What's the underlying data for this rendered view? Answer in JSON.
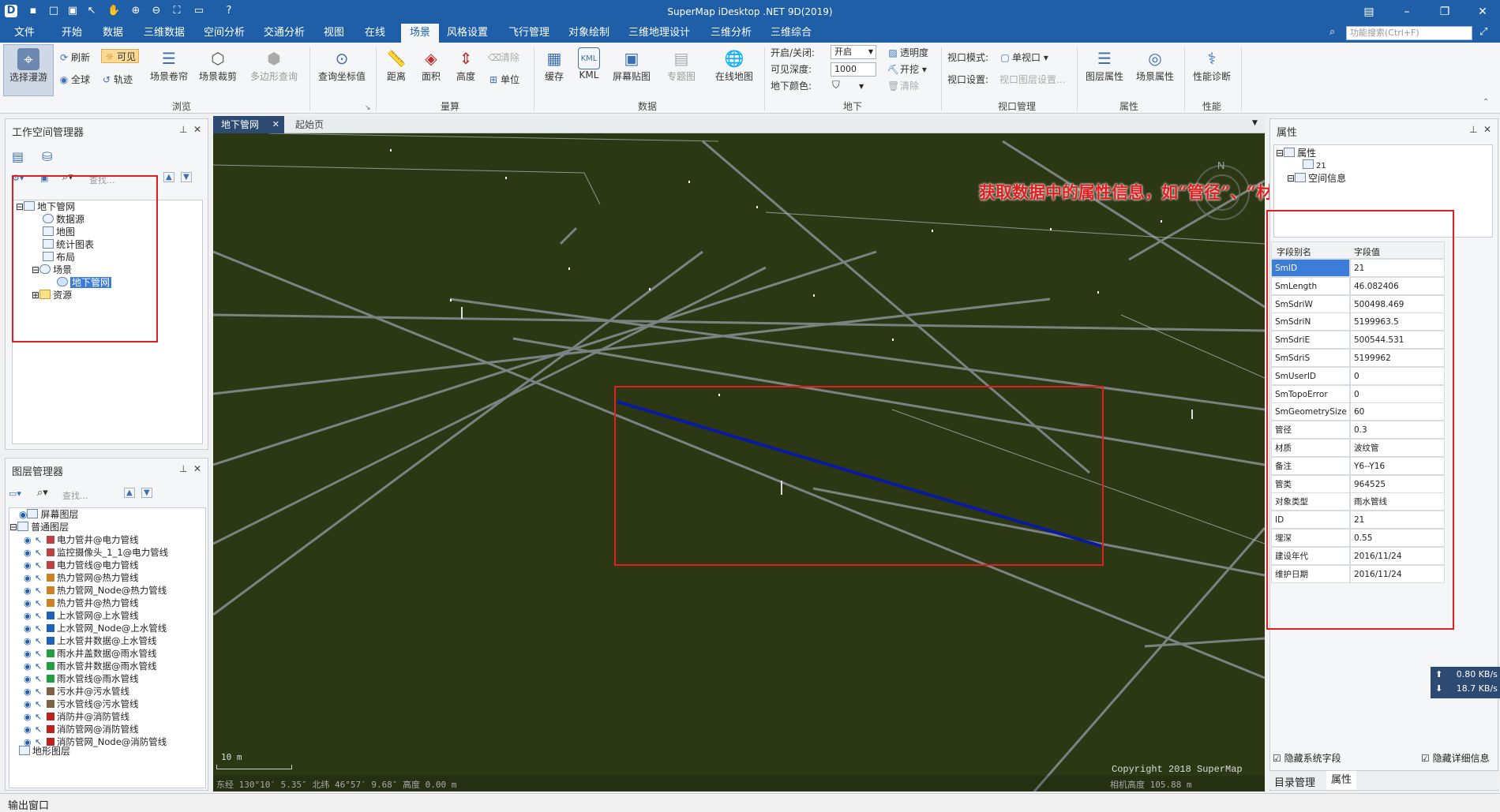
{
  "title_bar": {
    "title": "SuperMap iDesktop .NET 9D(2019)"
  },
  "menu": {
    "items": [
      "文件",
      "开始",
      "数据",
      "三维数据",
      "空间分析",
      "交通分析",
      "视图",
      "在线",
      "场景",
      "风格设置",
      "飞行管理",
      "对象绘制",
      "三维地理设计",
      "三维分析",
      "三维综合"
    ],
    "active": "场景",
    "search_placeholder": "功能搜索(Ctrl+F)"
  },
  "ribbon": {
    "browse": {
      "roam": "选择漫游",
      "refresh": "刷新",
      "visible": "可见",
      "full": "全球",
      "track": "轨迹",
      "scene_roll": "场景卷帘",
      "scene_clip": "场景裁剪",
      "polygon_query": "多边形查询",
      "group": "浏览"
    },
    "query_coord": "查询坐标值",
    "measure": {
      "distance": "距离",
      "area": "面积",
      "height": "高度",
      "clear": "清除",
      "unit": "单位",
      "group": "量算"
    },
    "data": {
      "cache": "缓存",
      "kml": "KML",
      "screen_map": "屏幕贴图",
      "thematic": "专题图",
      "online_map": "在线地图",
      "group": "数据"
    },
    "underground": {
      "toggle_label": "开启/关闭:",
      "toggle_value": "开启",
      "depth_label": "可见深度:",
      "depth_value": "1000",
      "color_label": "地下颜色:",
      "transparency": "透明度",
      "excavate": "开挖",
      "clear": "清除",
      "group": "地下"
    },
    "viewport": {
      "mode_label": "视口模式:",
      "mode_value": "单视口",
      "setting_label": "视口设置:",
      "setting_value": "视口图层设置...",
      "group": "视口管理"
    },
    "props": {
      "layer_prop": "图层属性",
      "scene_prop": "场景属性",
      "group": "属性"
    },
    "perf": {
      "diagnose": "性能诊断",
      "group": "性能"
    }
  },
  "workspace_panel": {
    "title": "工作空间管理器",
    "search_placeholder": "查找...",
    "tree": [
      "地下管网",
      "数据源",
      "地图",
      "统计图表",
      "布局",
      "场景",
      "地下管网",
      "资源"
    ]
  },
  "layer_panel": {
    "title": "图层管理器",
    "search_placeholder": "查找...",
    "groups": [
      "屏幕图层",
      "普通图层",
      "地形图层"
    ],
    "layers": [
      "电力管井@电力管线",
      "监控摄像头_1_1@电力管线",
      "电力管线@电力管线",
      "热力管网@热力管线",
      "热力管网_Node@热力管线",
      "热力管井@热力管线",
      "上水管网@上水管线",
      "上水管网_Node@上水管线",
      "上水管井数据@上水管线",
      "雨水井盖数据@雨水管线",
      "雨水管井数据@雨水管线",
      "雨水管线@雨水管线",
      "污水井@污水管线",
      "污水管线@污水管线",
      "消防井@消防管线",
      "消防管网@消防管线",
      "消防管网_Node@消防管线"
    ]
  },
  "doc_tabs": [
    "地下管网",
    "起始页"
  ],
  "scene": {
    "scale": "10 m",
    "coords": "东经 130°10′ 5.35″   北纬 46°57′ 9.68″   高度 0.00 m",
    "copyright": "Copyright 2018 SuperMap",
    "camera": "相机高度 105.88 m",
    "compass": "N"
  },
  "annotation": "获取数据中的属性信息，如“管径”、“材质”",
  "property_panel": {
    "title": "属性",
    "tree": [
      "属性",
      "21",
      "空间信息"
    ],
    "headers": [
      "字段别名",
      "字段值"
    ],
    "rows": [
      [
        "SmID",
        "21"
      ],
      [
        "SmLength",
        "46.082406"
      ],
      [
        "SmSdriW",
        "500498.469"
      ],
      [
        "SmSdriN",
        "5199963.5"
      ],
      [
        "SmSdriE",
        "500544.531"
      ],
      [
        "SmSdriS",
        "5199962"
      ],
      [
        "SmUserID",
        "0"
      ],
      [
        "SmTopoError",
        "0"
      ],
      [
        "SmGeometrySize",
        "60"
      ],
      [
        "管径",
        "0.3"
      ],
      [
        "材质",
        "波纹管"
      ],
      [
        "备注",
        "Y6--Y16"
      ],
      [
        "管类",
        "964525"
      ],
      [
        "对象类型",
        "雨水管线"
      ],
      [
        "ID",
        "21"
      ],
      [
        "埋深",
        "0.55"
      ],
      [
        "建设年代",
        "2016/11/24"
      ],
      [
        "维护日期",
        "2016/11/24"
      ]
    ],
    "hide_sys": "隐藏系统字段",
    "hide_detail": "隐藏详细信息",
    "bottom_tabs": [
      "目录管理",
      "属性"
    ],
    "net_up": "0.80 KB/s",
    "net_down": "18.7 KB/s"
  },
  "status": {
    "output": "输出窗口"
  }
}
